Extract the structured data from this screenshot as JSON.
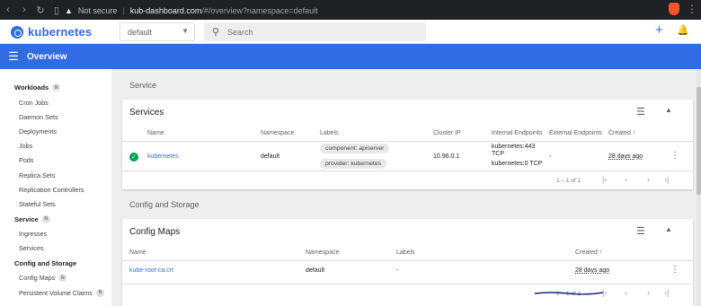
{
  "browser": {
    "security_label": "Not secure",
    "host": "kub-dashboard.com",
    "path": "/#/overview?namespace=default"
  },
  "app": {
    "title": "kubernetes",
    "namespace": "default",
    "search_placeholder": "Search"
  },
  "toolbar": {
    "title": "Overview"
  },
  "sidebar": {
    "sections": [
      {
        "label": "Workloads",
        "badge": "N",
        "items": [
          "Cron Jobs",
          "Daemon Sets",
          "Deployments",
          "Jobs",
          "Pods",
          "Replica Sets",
          "Replication Controllers",
          "Stateful Sets"
        ]
      },
      {
        "label": "Service",
        "badge": "N",
        "items": [
          "Ingresses",
          "Services"
        ]
      },
      {
        "label": "Config and Storage",
        "badge": "",
        "items": [
          "Config Maps",
          "Persistent Volume Claims"
        ]
      }
    ],
    "pvc_badge": "N"
  },
  "service_section": {
    "heading": "Service",
    "card_title": "Services",
    "columns": [
      "Name",
      "Namespace",
      "Labels",
      "Cluster IP",
      "Internal Endpoints",
      "External Endpoints",
      "Created ↑"
    ],
    "rows": [
      {
        "name": "kubernetes",
        "namespace": "default",
        "labels": [
          "component: apiserver",
          "provider: kubernetes"
        ],
        "cluster_ip": "10.96.0.1",
        "internal_endpoints": [
          "kubernetes:443",
          "TCP",
          "kubernetes:0 TCP"
        ],
        "external_endpoints": "-",
        "created": "28 days ago"
      }
    ],
    "pager": "1 – 1 of 1"
  },
  "config_section": {
    "heading": "Config and Storage",
    "card_title": "Config Maps",
    "columns": [
      "Name",
      "Namespace",
      "Labels",
      "Created ↑"
    ],
    "rows": [
      {
        "name": "kube-root-ca.crt",
        "namespace": "default",
        "labels": "-",
        "created": "28 days ago"
      }
    ],
    "pager": "1 – 1 of 1"
  },
  "icons": {
    "back": "arrow-left",
    "forward": "arrow-right",
    "reload": "reload",
    "bookmark": "bookmark",
    "warning": "warning-triangle",
    "filter": "filter",
    "collapse": "chevron-up",
    "more": "kebab-menu",
    "status_ok": "check-circle",
    "add": "plus",
    "notifications": "bell"
  },
  "colors": {
    "brand": "#326ce5",
    "status_ok": "#00a152"
  }
}
